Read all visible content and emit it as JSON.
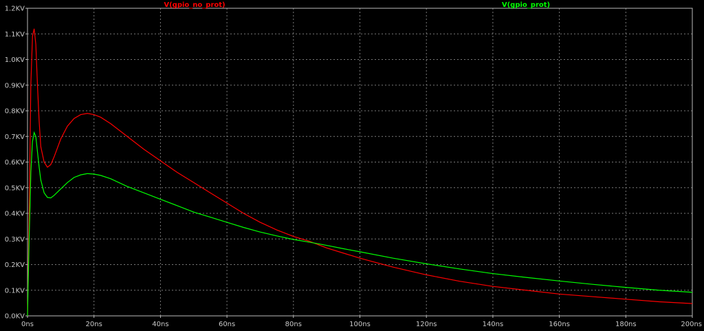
{
  "chart_data": {
    "type": "line",
    "title": "",
    "xlabel": "",
    "ylabel": "",
    "xlim": [
      0,
      200
    ],
    "ylim": [
      0,
      1200
    ],
    "grid": true,
    "legend_placement": "top",
    "x_tick_labels": [
      "0ns",
      "20ns",
      "40ns",
      "60ns",
      "80ns",
      "100ns",
      "120ns",
      "140ns",
      "160ns",
      "180ns",
      "200ns"
    ],
    "x_ticks": [
      0,
      20,
      40,
      60,
      80,
      100,
      120,
      140,
      160,
      180,
      200
    ],
    "y_tick_labels": [
      "0.0KV",
      "0.1KV",
      "0.2KV",
      "0.3KV",
      "0.4KV",
      "0.5KV",
      "0.6KV",
      "0.7KV",
      "0.8KV",
      "0.9KV",
      "1.0KV",
      "1.1KV",
      "1.2KV"
    ],
    "y_ticks": [
      0,
      100,
      200,
      300,
      400,
      500,
      600,
      700,
      800,
      900,
      1000,
      1100,
      1200
    ],
    "series": [
      {
        "name": "V(gpio_no_prot)",
        "color": "#ff0000",
        "x": [
          0,
          0.5,
          1.0,
          1.5,
          2.0,
          2.5,
          3.0,
          3.5,
          4.0,
          5.0,
          6.0,
          7.0,
          8.0,
          10,
          12,
          14,
          16,
          18,
          20,
          22,
          25,
          30,
          35,
          40,
          45,
          50,
          55,
          60,
          65,
          70,
          75,
          80,
          85,
          90,
          95,
          100,
          110,
          120,
          130,
          140,
          150,
          160,
          170,
          180,
          190,
          200
        ],
        "y": [
          0,
          400,
          900,
          1090,
          1120,
          1060,
          900,
          760,
          660,
          600,
          580,
          590,
          620,
          690,
          740,
          770,
          785,
          790,
          785,
          775,
          750,
          700,
          650,
          605,
          560,
          520,
          480,
          440,
          400,
          365,
          335,
          310,
          290,
          265,
          245,
          225,
          190,
          160,
          135,
          115,
          100,
          85,
          75,
          65,
          55,
          48
        ]
      },
      {
        "name": "V(gpio_prot)",
        "color": "#00ff00",
        "x": [
          0,
          0.5,
          1.0,
          1.5,
          2.0,
          2.5,
          3.0,
          3.5,
          4.0,
          5.0,
          6.0,
          7.0,
          8.0,
          10,
          12,
          14,
          16,
          18,
          20,
          22,
          25,
          30,
          35,
          40,
          45,
          50,
          55,
          60,
          65,
          70,
          75,
          80,
          85,
          90,
          95,
          100,
          110,
          120,
          130,
          140,
          150,
          160,
          170,
          180,
          190,
          200
        ],
        "y": [
          0,
          300,
          560,
          680,
          715,
          700,
          640,
          580,
          530,
          480,
          462,
          460,
          470,
          495,
          520,
          540,
          550,
          555,
          553,
          548,
          535,
          505,
          480,
          455,
          430,
          405,
          385,
          365,
          345,
          327,
          312,
          298,
          287,
          275,
          262,
          250,
          225,
          203,
          183,
          165,
          150,
          136,
          123,
          111,
          100,
          92
        ]
      }
    ]
  }
}
